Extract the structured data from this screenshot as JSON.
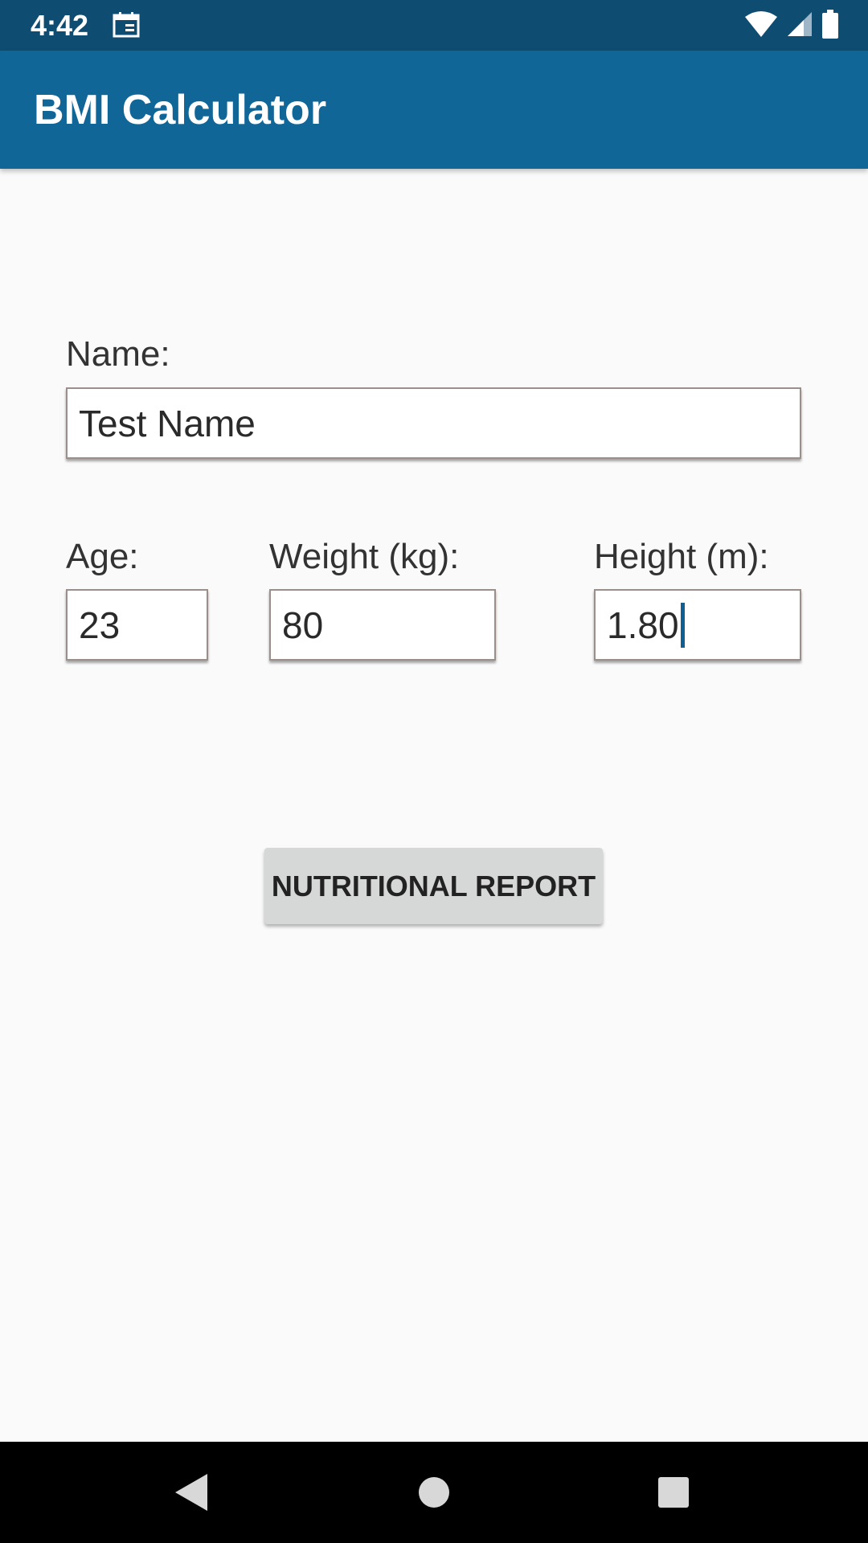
{
  "status_bar": {
    "time": "4:42",
    "icons": [
      "calendar-icon",
      "wifi-icon",
      "signal-icon",
      "battery-icon"
    ]
  },
  "app_bar": {
    "title": "BMI Calculator"
  },
  "form": {
    "name_label": "Name:",
    "name_value": "Test Name",
    "age_label": "Age:",
    "age_value": "23",
    "weight_label": "Weight (kg):",
    "weight_value": "80",
    "height_label": "Height (m):",
    "height_value": "1.80"
  },
  "actions": {
    "report_label": "NUTRITIONAL REPORT"
  },
  "nav_bar": {
    "icons": [
      "back-icon",
      "home-icon",
      "recents-icon"
    ]
  },
  "colors": {
    "status_bar": "#0f4c72",
    "app_bar": "#116698",
    "background": "#fafafa",
    "button": "#d6d7d7"
  }
}
